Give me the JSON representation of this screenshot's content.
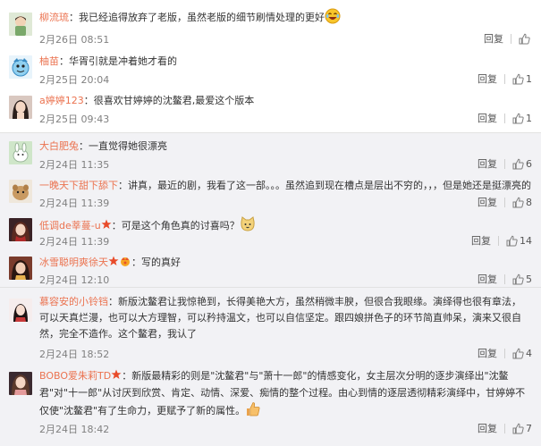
{
  "labels": {
    "reply": "回复"
  },
  "colors": {
    "username": "#eb7350",
    "date": "#808080",
    "panel_bg": "#f2f2f5"
  },
  "comments": [
    {
      "user": "柳流琉",
      "text": "：我已经追得放弃了老版，虽然老版的细节刷情处理的更好",
      "date": "2月26日 08:51",
      "likes": "",
      "emoji": "laughing-emoji"
    },
    {
      "user": "柚苗",
      "text": "：华胥引就是冲着她才看的",
      "date": "2月25日 20:04",
      "likes": "1"
    },
    {
      "user": "a婷婷123",
      "text": "：很喜欢甘婷婷的沈鳌君,最爱这个版本",
      "date": "2月25日 09:43",
      "likes": "1"
    },
    {
      "user": "大白肥兔",
      "text": "：一直觉得她很漂亮",
      "date": "2月24日 11:35",
      "likes": "6"
    },
    {
      "user": "一晚天下甜下舔下",
      "text": "：讲真，最近的剧，我看了这一部。。。虽然追到现在槽点是层出不穷的，，，但是她还是挺漂亮的",
      "date": "2月24日 11:39",
      "likes": "8"
    },
    {
      "user": "低调de莘蔓-u",
      "text": "：可是这个角色真的讨喜吗？",
      "date": "2月24日 11:39",
      "likes": "14",
      "emoji": "cat-emoji"
    },
    {
      "user": "冰雪聪明爽徐天",
      "text": "：写的真好",
      "date": "2月24日 12:10",
      "likes": "5"
    },
    {
      "user": "慕容安的小铃铛",
      "text": "：新版沈鳌君让我惊艳到，长得美艳大方，虽然稍微丰腴，但很合我眼缘。演绎得也很有章法，可以天真烂漫，也可以大方理智，可以矜持温文，也可以自信坚定。跟四娘拼色子的环节简直帅呆，演来又很自然，完全不造作。这个鳌君，我认了",
      "date": "2月24日 18:52",
      "likes": "4"
    },
    {
      "user": "BOBO爱朱莉TD",
      "text": "：新版最精彩的则是\"沈鳌君\"与\"萧十一郎\"的情感变化，女主层次分明的逐步演绎出\"沈鳌君\"对\"十一郎\"从讨厌到欣赏、肯定、动情、深爱、痴情的整个过程。由心到情的逐层透彻精彩演绎中，甘婷婷不仅使\"沈鳌君\"有了生命力，更赋予了新的属性。",
      "date": "2月24日 18:42",
      "likes": "7",
      "emoji": "thumbs-up-emoji"
    }
  ]
}
